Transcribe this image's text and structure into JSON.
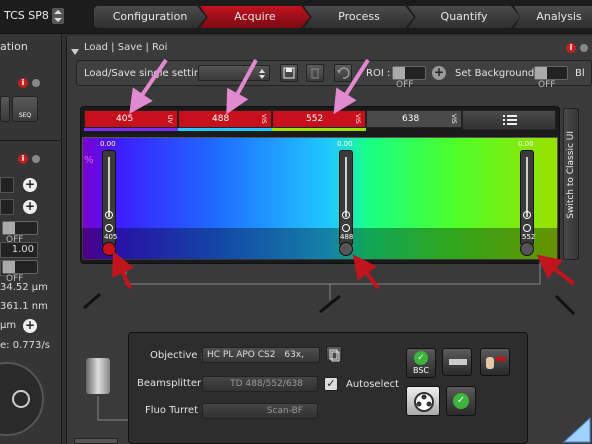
{
  "device": {
    "name": "TCS SP8"
  },
  "workflow": {
    "tabs": [
      {
        "label": "Configuration"
      },
      {
        "label": "Acquire"
      },
      {
        "label": "Process"
      },
      {
        "label": "Quantify"
      },
      {
        "label": "Analysis"
      }
    ],
    "active": "Acquire"
  },
  "left_panel": {
    "title_fragment": "ation",
    "seq_label": "SEQ",
    "field_value_1": "1.00",
    "toggle_1": "OFF",
    "toggle_2": "OFF",
    "value_a": "34.52 µm",
    "value_b": "361.1 nm",
    "unit_um": "µm",
    "speed": "e: 0.773/s"
  },
  "load_panel": {
    "header": "Load | Save | Roi",
    "load_save_label": "Load/Save single setting :",
    "roi_label": "ROI :",
    "roi_toggle": "OFF",
    "background_label": "Set Background :",
    "background_toggle": "OFF",
    "trailing_text": "Bl"
  },
  "lasers": {
    "tabs": [
      {
        "wavelength": "405",
        "side": "UV",
        "color": "#c8101c",
        "underline": "#7a30ff"
      },
      {
        "wavelength": "488",
        "side": "VIS",
        "color": "#c8101c",
        "underline": "#22c8ff"
      },
      {
        "wavelength": "552",
        "side": "VIS",
        "color": "#c8101c",
        "underline": "#9ee000"
      },
      {
        "wavelength": "638",
        "side": "VIS",
        "color": "#4a4a4a",
        "underline": "#4a4a4a"
      }
    ],
    "list_icon": "list-icon",
    "percent_label": "%",
    "sliders": [
      {
        "top_value": "0.00",
        "label": "405",
        "knob_color": "#c8101c"
      },
      {
        "top_value": "0.00",
        "label": "488",
        "knob_color": "#555555"
      },
      {
        "top_value": "0.00",
        "label": "552",
        "knob_color": "#555555"
      }
    ],
    "classic_button": "Switch to Classic UI"
  },
  "objective_box": {
    "objective_label": "Objective :",
    "objective_value": "HC PL APO CS2",
    "objective_mag": "63x,",
    "beamsplitter_label": "Beamsplitter :",
    "beamsplitter_value": "TD 488/552/638",
    "autoselect_label": "Autoselect",
    "fluo_label": "Fluo Turret :",
    "fluo_value": "Scan-BF",
    "bsc_label": "BSC"
  },
  "colors": {
    "accent_red": "#c8101c",
    "annotation_pink": "#e28ad0",
    "annotation_red": "#c0141e",
    "ok_green": "#3bb53b"
  }
}
